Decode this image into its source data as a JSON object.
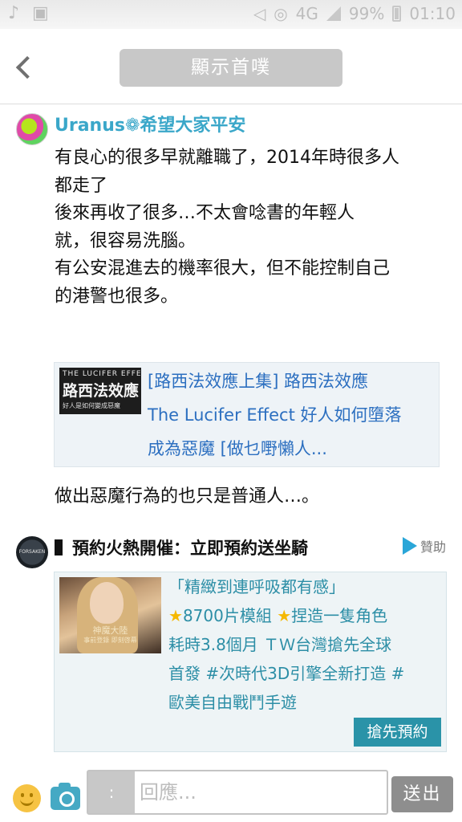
{
  "status_bar": {
    "network": "4G",
    "battery": "99%",
    "time": "01:10"
  },
  "header": {
    "title": "顯示首噗"
  },
  "post": {
    "username": "Uranus❁希望大家平安",
    "lines": [
      "有良心的很多早就離職了，2014年時很多人",
      "都走了",
      "後來再收了很多…不太會唸書的年輕人",
      "就，很容易洗腦。",
      "有公安混進去的機率很大，但不能控制自己",
      "的港警也很多。"
    ],
    "link_preview": {
      "thumb_line1": "THE LUCIFER EFFECT",
      "thumb_line2": "路西法效應",
      "thumb_line3": "好人是如何變成惡魔",
      "lines": [
        "[路西法效應上集] 路西法效應",
        "The Lucifer Effect 好人如何墮落",
        "成為惡魔 [做乜嘢懶人..."
      ]
    },
    "closing": "做出惡魔行為的也只是普通人…。"
  },
  "sponsored": {
    "avatar_text": "FORSAKEN WORLD",
    "title": "預約火熱開催：立即預約送坐騎",
    "sponsor_label": "贊助",
    "thumb_logo": "神魔大陸",
    "thumb_sub": "事前登錄 即刻啓幕",
    "lines": [
      "「精緻到連呼吸都有感」",
      "8700片模組 ",
      "捏造一隻角色",
      "耗時3.8個月 ＴＷ台灣搶先全球",
      "首發 #次時代3D引擎全新打造 #",
      "歐美自由戰鬥手遊"
    ],
    "cta": "搶先預約"
  },
  "bottom_bar": {
    "quote_label": ":",
    "reply_placeholder": "回應...",
    "send_label": "送出"
  }
}
